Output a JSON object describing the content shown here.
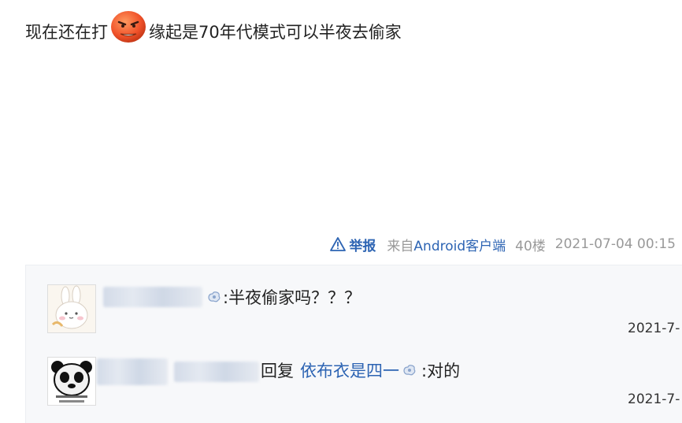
{
  "post": {
    "text_before": "现在还在打",
    "emoji_icon": "angry-face-emoji-icon",
    "text_after": "缘起是70年代模式可以半夜去偷家"
  },
  "meta": {
    "report_label": "举报",
    "source_prefix": "来自",
    "source_app": "Android客户端",
    "floor": "40楼",
    "time": "2021-07-04 00:15"
  },
  "comments": [
    {
      "text": ":半夜偷家吗？？？",
      "time": "2021-7-"
    },
    {
      "reply_label": "回复",
      "reply_to": "依布衣是四一",
      "text": ":对的",
      "time": "2021-7-"
    }
  ],
  "colors": {
    "link": "#2d64b3",
    "meta_gray": "#999999",
    "comment_bg": "#f7f8fa"
  }
}
